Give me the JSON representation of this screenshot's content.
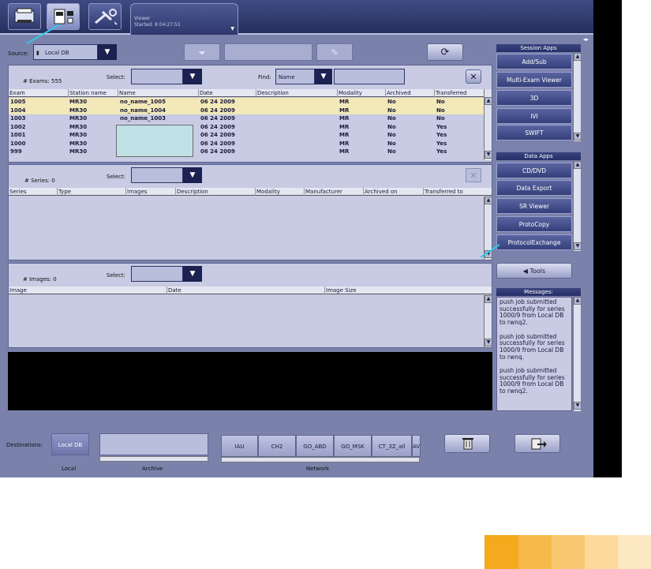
{
  "top": {
    "viewer_tab": {
      "title": "Viewer",
      "subtitle": "Started: 8 04:27:51"
    }
  },
  "source": {
    "label": "Source:",
    "value": "Local DB"
  },
  "exams": {
    "count_label": "# Exams: 555",
    "select_label": "Select:",
    "find_label": "Find:",
    "find_value": "Name",
    "columns": [
      "Exam",
      "Station name",
      "Name",
      "Date",
      "Description",
      "Modality",
      "Archived",
      "Transferred"
    ],
    "rows": [
      {
        "exam": "1005",
        "station": "MR30",
        "name": "no_name_1005",
        "date": "06 24 2009",
        "modality": "MR",
        "archived": "No",
        "transferred": "No"
      },
      {
        "exam": "1004",
        "station": "MR30",
        "name": "no_name_1004",
        "date": "06 24 2009",
        "modality": "MR",
        "archived": "No",
        "transferred": "No"
      },
      {
        "exam": "1003",
        "station": "MR30",
        "name": "no_name_1003",
        "date": "06 24 2009",
        "modality": "MR",
        "archived": "No",
        "transferred": "No"
      },
      {
        "exam": "1002",
        "station": "MR30",
        "name": "",
        "date": "06 24 2009",
        "modality": "MR",
        "archived": "No",
        "transferred": "Yes"
      },
      {
        "exam": "1001",
        "station": "MR30",
        "name": "",
        "date": "06 24 2009",
        "modality": "MR",
        "archived": "No",
        "transferred": "Yes"
      },
      {
        "exam": "1000",
        "station": "MR30",
        "name": "",
        "date": "06 24 2009",
        "modality": "MR",
        "archived": "No",
        "transferred": "Yes"
      },
      {
        "exam": "999",
        "station": "MR30",
        "name": "",
        "date": "06 24 2009",
        "modality": "MR",
        "archived": "No",
        "transferred": "Yes"
      }
    ]
  },
  "series": {
    "count_label": "# Series: 0",
    "select_label": "Select:",
    "columns": [
      "Series",
      "Type",
      "Images",
      "Description",
      "Modality",
      "Manufacturer",
      "Archived on",
      "Transferred to"
    ]
  },
  "images": {
    "count_label": "# Images: 0",
    "select_label": "Select:",
    "columns": [
      "Image",
      "Date",
      "Image Size"
    ]
  },
  "session_apps": {
    "title": "Session Apps",
    "items": [
      "Add/Sub",
      "Multi-Exam Viewer",
      "3D",
      "IVI",
      "SWIFT"
    ]
  },
  "data_apps": {
    "title": "Data Apps",
    "items": [
      "CD/DVD",
      "Data Export",
      "SR Viewer",
      "ProtoCopy",
      "ProtocolExchange"
    ]
  },
  "tools_label": "Tools",
  "messages": {
    "title": "Messages:",
    "lines": [
      "push job submitted",
      "successfully for series",
      "1000/9 from Local DB",
      "to rwnq2.",
      "",
      "push job submitted",
      "successfully for series",
      "1000/9 from Local DB",
      "to rwnq.",
      "",
      "push job submitted",
      "successfully for series",
      "1000/9 from Local DB",
      "to rwnq2."
    ]
  },
  "destinations": {
    "label": "Destinations:",
    "local_button": "Local DB",
    "local_caption": "Local",
    "archive_caption": "Archive",
    "network_caption": "Network",
    "network_tabs": [
      "IAU",
      "CH2",
      "GO_ABD",
      "GO_MSK",
      "CT_3Z_all",
      "AV"
    ]
  },
  "colors": {
    "accent": "#2b3470",
    "selected_row": "#f2e8b8",
    "highlight_cyan": "#35c8e6"
  },
  "palette": [
    "#f5a91c",
    "#f7b94a",
    "#f9c971",
    "#fbd99b",
    "#fde8c4"
  ]
}
